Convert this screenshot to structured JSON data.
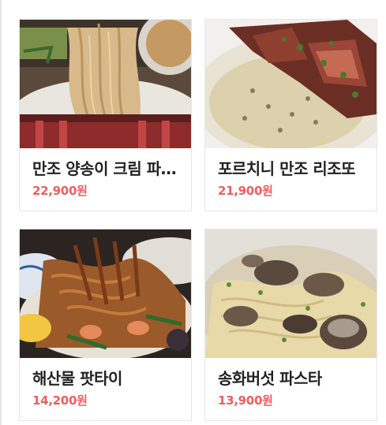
{
  "menu": [
    {
      "name": "만조 양송이 크림 파스타",
      "price": "22,900원",
      "image_icon": "cream-pasta-steak-photo"
    },
    {
      "name": "포르치니 만조 리조또",
      "price": "21,900원",
      "image_icon": "risotto-steak-photo"
    },
    {
      "name": "해산물 팟타이",
      "price": "14,200원",
      "image_icon": "seafood-padthai-photo"
    },
    {
      "name": "송화버섯 파스타",
      "price": "13,900원",
      "image_icon": "mushroom-pasta-photo"
    }
  ],
  "colors": {
    "price": "#f25c5c",
    "name": "#222222",
    "card_border": "#e7e7e7"
  }
}
